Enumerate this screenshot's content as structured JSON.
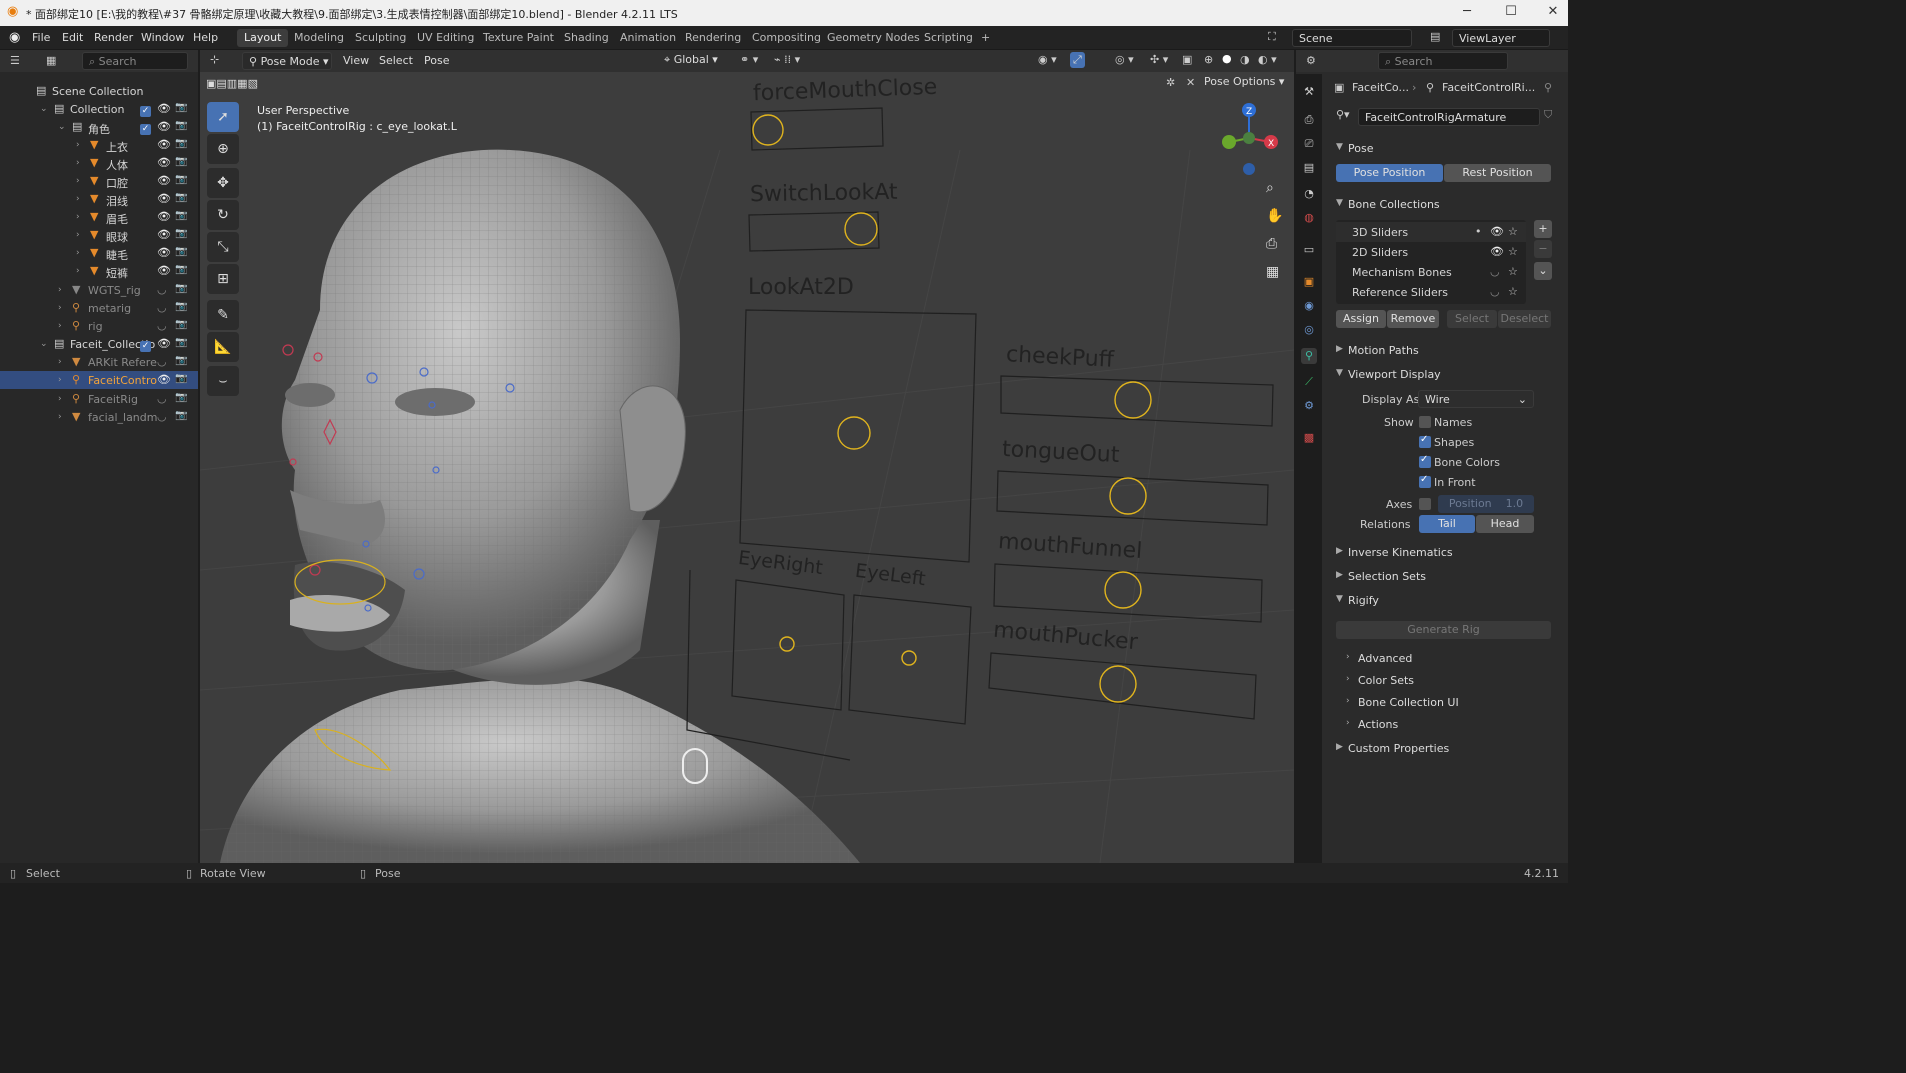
{
  "titlebar": {
    "title": "* 面部绑定10 [E:\\我的教程\\#37 骨骼绑定原理\\收藏大教程\\9.面部绑定\\3.生成表情控制器\\面部绑定10.blend] - Blender 4.2.11 LTS",
    "minimize": "─",
    "maximize": "☐",
    "close": "✕"
  },
  "menus": [
    "File",
    "Edit",
    "Render",
    "Window",
    "Help"
  ],
  "workspaces": [
    "Layout",
    "Modeling",
    "Sculpting",
    "UV Editing",
    "Texture Paint",
    "Shading",
    "Animation",
    "Rendering",
    "Compositing",
    "Geometry Nodes",
    "Scripting",
    "+"
  ],
  "scene": "Scene",
  "viewlayer": "ViewLayer",
  "outliner": {
    "search_placeholder": "Search",
    "items": [
      {
        "label": "Scene Collection",
        "depth": 0
      },
      {
        "label": "Collection",
        "depth": 1
      },
      {
        "label": "角色",
        "depth": 2
      },
      {
        "label": "上衣",
        "depth": 3
      },
      {
        "label": "人体",
        "depth": 3
      },
      {
        "label": "口腔",
        "depth": 3
      },
      {
        "label": "泪线",
        "depth": 3
      },
      {
        "label": "眉毛",
        "depth": 3
      },
      {
        "label": "眼球",
        "depth": 3
      },
      {
        "label": "睫毛",
        "depth": 3
      },
      {
        "label": "短裤",
        "depth": 3
      },
      {
        "label": "WGTS_rig",
        "depth": 2
      },
      {
        "label": "metarig",
        "depth": 2
      },
      {
        "label": "rig",
        "depth": 2
      },
      {
        "label": "Faceit_Collectio",
        "depth": 1
      },
      {
        "label": "ARKit Refere",
        "depth": 2
      },
      {
        "label": "FaceitContro",
        "depth": 2
      },
      {
        "label": "FaceitRig",
        "depth": 2
      },
      {
        "label": "facial_landm",
        "depth": 2
      }
    ]
  },
  "viewport": {
    "mode": "Pose Mode",
    "menus": [
      "View",
      "Select",
      "Pose"
    ],
    "orientation": "Global",
    "pose_options": "Pose Options",
    "hud_line1": "User Perspective",
    "hud_line2": "(1) FaceitControlRig : c_eye_lookat.L",
    "controls": [
      "forceMouthClose",
      "SwitchLookAt",
      "LookAt2D",
      "cheekPuff",
      "tongueOut",
      "mouthFunnel",
      "mouthPucker",
      "EyeRight",
      "EyeLeft"
    ]
  },
  "props": {
    "search_placeholder": "Search",
    "breadcrumb_1": "FaceitCo...",
    "breadcrumb_2": "FaceitControlRi...",
    "armature_name": "FaceitControlRigArmature",
    "pose_header": "Pose",
    "pose_position": "Pose Position",
    "rest_position": "Rest Position",
    "bone_collections_header": "Bone Collections",
    "bone_collections": [
      "3D Sliders",
      "2D Sliders",
      "Mechanism Bones",
      "Reference Sliders"
    ],
    "assign": "Assign",
    "remove": "Remove",
    "select": "Select",
    "deselect": "Deselect",
    "motion_paths": "Motion Paths",
    "viewport_display": "Viewport Display",
    "display_as_label": "Display As",
    "display_as": "Wire",
    "show_label": "Show",
    "names": "Names",
    "shapes": "Shapes",
    "bone_colors": "Bone Colors",
    "in_front": "In Front",
    "axes_label": "Axes",
    "axes_position": "Position",
    "axes_value": "1.0",
    "relations_label": "Relations",
    "tail": "Tail",
    "head": "Head",
    "inverse_kinematics": "Inverse Kinematics",
    "selection_sets": "Selection Sets",
    "rigify": "Rigify",
    "generate_rig": "Generate Rig",
    "advanced": "Advanced",
    "color_sets": "Color Sets",
    "bone_collection_ui": "Bone Collection UI",
    "actions": "Actions",
    "custom_properties": "Custom Properties"
  },
  "status": {
    "select": "Select",
    "rotate": "Rotate View",
    "pose": "Pose",
    "version": "4.2.11"
  }
}
